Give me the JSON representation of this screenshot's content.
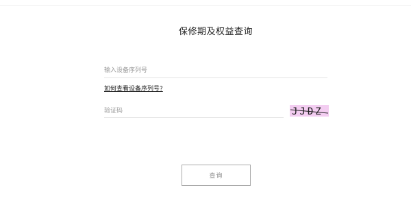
{
  "page": {
    "title": "保修期及权益查询"
  },
  "form": {
    "serial_placeholder": "输入设备序列号",
    "help_link": "如何查看设备序列号?",
    "captcha_placeholder": "验证码",
    "captcha_text": "JJDZ",
    "captcha_color": "#f3cdf1",
    "submit_label": "查询"
  }
}
